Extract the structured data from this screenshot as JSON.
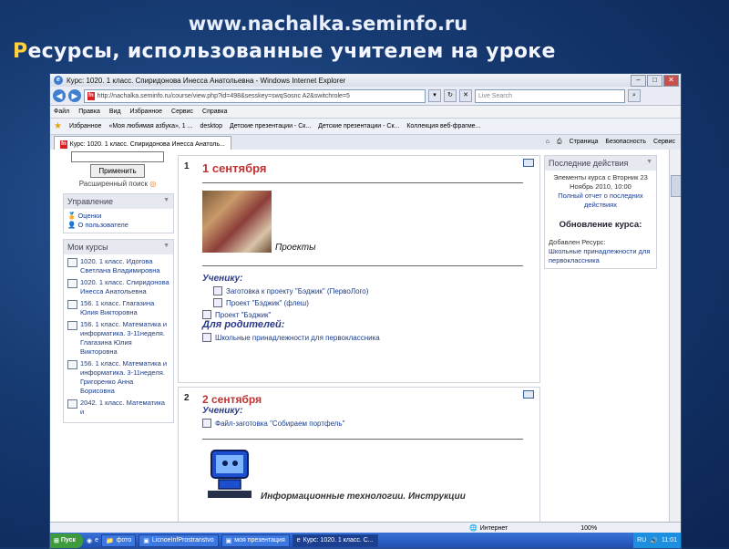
{
  "slide": {
    "url": "www.nachalka.seminfo.ru",
    "title_first": "Р",
    "title_rest": "есурсы, использованные учителем на уроке"
  },
  "browser": {
    "window_title": "Курс: 1020. 1 класс. Спиридонова Инесса Анатольевна - Windows Internet Explorer",
    "address": "http://nachalka.seminfo.ru/course/view.php?id=498&sesskey=swqSosnc A2&switchrole=5",
    "search_placeholder": "Live Search",
    "menu": [
      "Файл",
      "Правка",
      "Вид",
      "Избранное",
      "Сервис",
      "Справка"
    ],
    "favorites_label": "Избранное",
    "favorites": [
      "«Моя любимая азбука», 1 ...",
      "desktop",
      "Детские презентации - Ск...",
      "Детские презентации - Ск...",
      "Коллекция веб-фрагме..."
    ],
    "tab_label": "Курс: 1020. 1 класс. Спиридонова Инесса Анатоль...",
    "tab_tools": [
      "Страница",
      "Безопасность",
      "Сервис"
    ],
    "status_text": "Интернет",
    "zoom": "100%"
  },
  "left": {
    "apply_label": "Применить",
    "advanced_search": "Расширенный поиск",
    "manage_title": "Управление",
    "manage_items": [
      "Оценки",
      "О пользователе"
    ],
    "courses_title": "Мои курсы",
    "courses": [
      "1020. 1 класс. Идогова Светлана Владимировна",
      "1020. 1 класс. Спиридонова Инесса Анатольевна",
      "156. 1 класс. Глагазина Юлия Викторовна",
      "156. 1 класс. Математика и информатика. 3-11неделя. Глагазина Юлия Викторовна",
      "156. 1 класс. Математика и информатика. 3-11неделя. Григоренко Анна Борисовна",
      "2042. 1 класс. Математика и"
    ]
  },
  "sections": [
    {
      "num": "1",
      "title": "1 сентября",
      "photo_caption": "Проекты",
      "student_label": "Ученику:",
      "student_items": [
        "Заготовка к проекту \"Бэджик\" (ПервоЛого)",
        "Проект \"Бэджик\" (флеш)"
      ],
      "extra_item": "Проект \"Бэджик\"",
      "parent_label": "Для родителей:",
      "parent_items": [
        "Школьные принадлежности для первоклассника"
      ]
    },
    {
      "num": "2",
      "title": "2 сентября",
      "student_label": "Ученику:",
      "student_items": [
        "Файл-заготовка \"Собираем портфель\""
      ],
      "robot_caption": "Информационные технологии. Инструкции"
    }
  ],
  "right": {
    "recent_title": "Последние действия",
    "recent_text": "Элементы курса с Вторник 23 Ноябрь 2010, 10:00",
    "recent_link": "Полный отчет о последних действиях",
    "update_title": "Обновление курса:",
    "added_label": "Добавлен Ресурс:",
    "added_link": "Школьные принадлежности для первоклассника"
  },
  "taskbar": {
    "start": "Пуск",
    "items": [
      "фото",
      "LicnoeInfProstranstvo",
      "моя презентация",
      "Курс: 1020. 1 класс. С..."
    ],
    "lang": "RU",
    "time": "11:01"
  }
}
